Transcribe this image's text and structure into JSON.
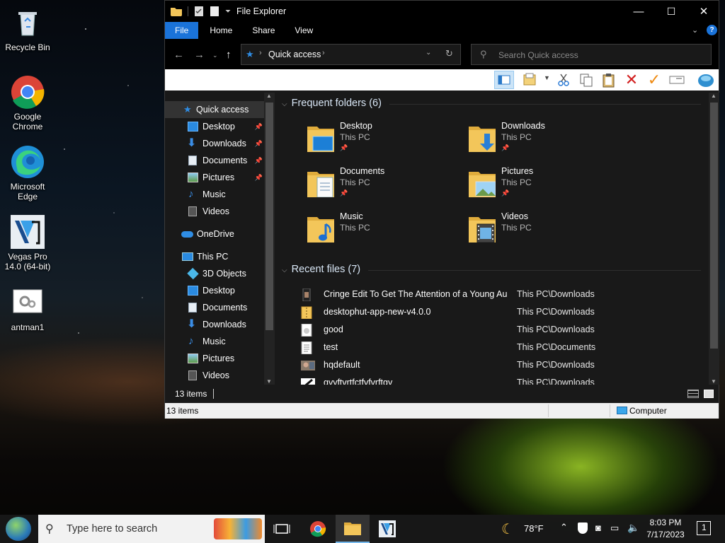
{
  "desktop": {
    "icons": [
      {
        "label": "Recycle Bin",
        "icon": "recycle-bin-icon"
      },
      {
        "label": "Google Chrome",
        "icon": "chrome-icon"
      },
      {
        "label": "Microsoft Edge",
        "icon": "edge-icon"
      },
      {
        "label": "Vegas Pro 14.0 (64-bit)",
        "icon": "vegas-pro-icon"
      },
      {
        "label": "antman1",
        "icon": "file-icon"
      }
    ]
  },
  "window": {
    "title": "File Explorer",
    "controls": {
      "minimize": "—",
      "maximize": "☐",
      "close": "✕"
    },
    "ribbon_tabs": [
      "File",
      "Home",
      "Share",
      "View"
    ],
    "address": {
      "segments": [
        "Quick access"
      ]
    },
    "search": {
      "placeholder": "Search Quick access"
    },
    "nav": {
      "quick_access": "Quick access",
      "quick_items": [
        {
          "label": "Desktop",
          "pinned": true
        },
        {
          "label": "Downloads",
          "pinned": true
        },
        {
          "label": "Documents",
          "pinned": true
        },
        {
          "label": "Pictures",
          "pinned": true
        },
        {
          "label": "Music",
          "pinned": false
        },
        {
          "label": "Videos",
          "pinned": false
        }
      ],
      "onedrive": "OneDrive",
      "this_pc": "This PC",
      "pc_items": [
        "3D Objects",
        "Desktop",
        "Documents",
        "Downloads",
        "Music",
        "Pictures",
        "Videos"
      ]
    },
    "frequent": {
      "header": "Frequent folders (6)",
      "folders": [
        {
          "name": "Desktop",
          "location": "This PC",
          "pinned": true
        },
        {
          "name": "Downloads",
          "location": "This PC",
          "pinned": true
        },
        {
          "name": "Documents",
          "location": "This PC",
          "pinned": true
        },
        {
          "name": "Pictures",
          "location": "This PC",
          "pinned": true
        },
        {
          "name": "Music",
          "location": "This PC",
          "pinned": false
        },
        {
          "name": "Videos",
          "location": "This PC",
          "pinned": false
        }
      ]
    },
    "recent": {
      "header": "Recent files (7)",
      "files": [
        {
          "name": "Cringe Edit To Get The Attention of a Young Au...",
          "path": "This PC\\Downloads"
        },
        {
          "name": "desktophut-app-new-v4.0.0",
          "path": "This PC\\Downloads"
        },
        {
          "name": "good",
          "path": "This PC\\Downloads"
        },
        {
          "name": "test",
          "path": "This PC\\Documents"
        },
        {
          "name": "hqdefault",
          "path": "This PC\\Downloads"
        },
        {
          "name": "gvyftvrtfctfvfvrftgy",
          "path": "This PC\\Downloads"
        }
      ]
    },
    "status": {
      "items": "13 items",
      "items_outer": "13 items",
      "computer": "Computer"
    }
  },
  "taskbar": {
    "search_placeholder": "Type here to search",
    "weather": "78°F",
    "time": "8:03 PM",
    "date": "7/17/2023",
    "notifications": "1"
  },
  "colors": {
    "accent": "#1a73d9",
    "folder": "#f3c65a",
    "window_bg": "#191919"
  }
}
